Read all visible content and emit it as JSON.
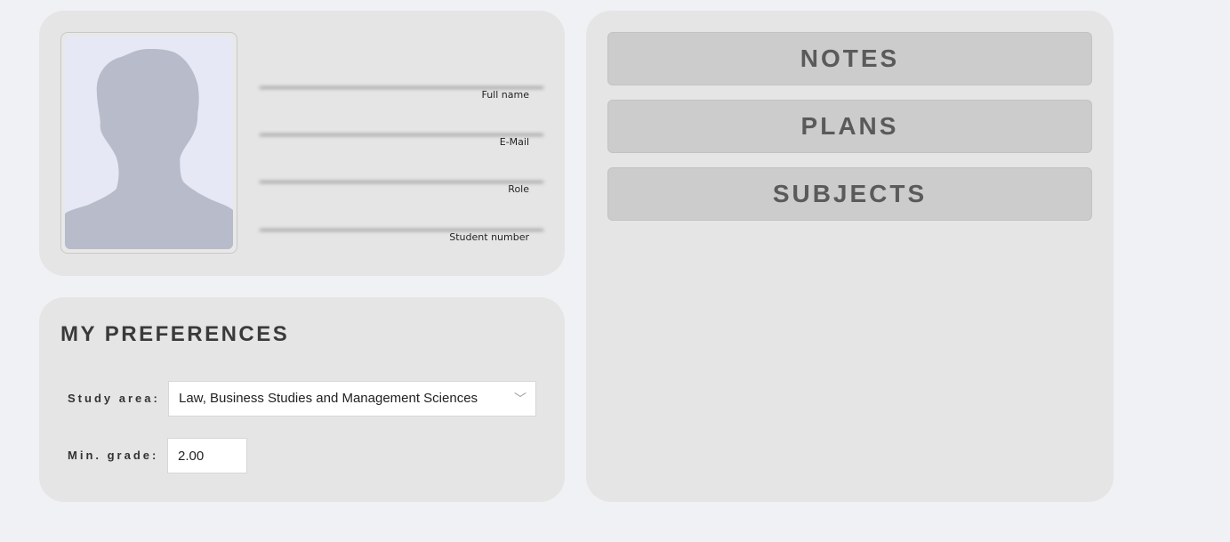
{
  "profile": {
    "fields": [
      {
        "caption": "Full name",
        "value": ""
      },
      {
        "caption": "E-Mail",
        "value": ""
      },
      {
        "caption": "Role",
        "value": ""
      },
      {
        "caption": "Student number",
        "value": ""
      }
    ],
    "photo_icon": "avatar-placeholder-icon"
  },
  "preferences": {
    "title": "MY PREFERENCES",
    "study_area_label": "Study area:",
    "study_area_value": "Law, Business Studies and Management Sciences",
    "min_grade_label": "Min. grade:",
    "min_grade_value": "2.00"
  },
  "nav": {
    "notes_label": "NOTES",
    "plans_label": "PLANS",
    "subjects_label": "SUBJECTS"
  },
  "colors": {
    "page_bg": "#f0f1f5",
    "card_bg": "#e5e5e5",
    "button_bg": "#cccccc",
    "silhouette": "#b8bbc9"
  }
}
